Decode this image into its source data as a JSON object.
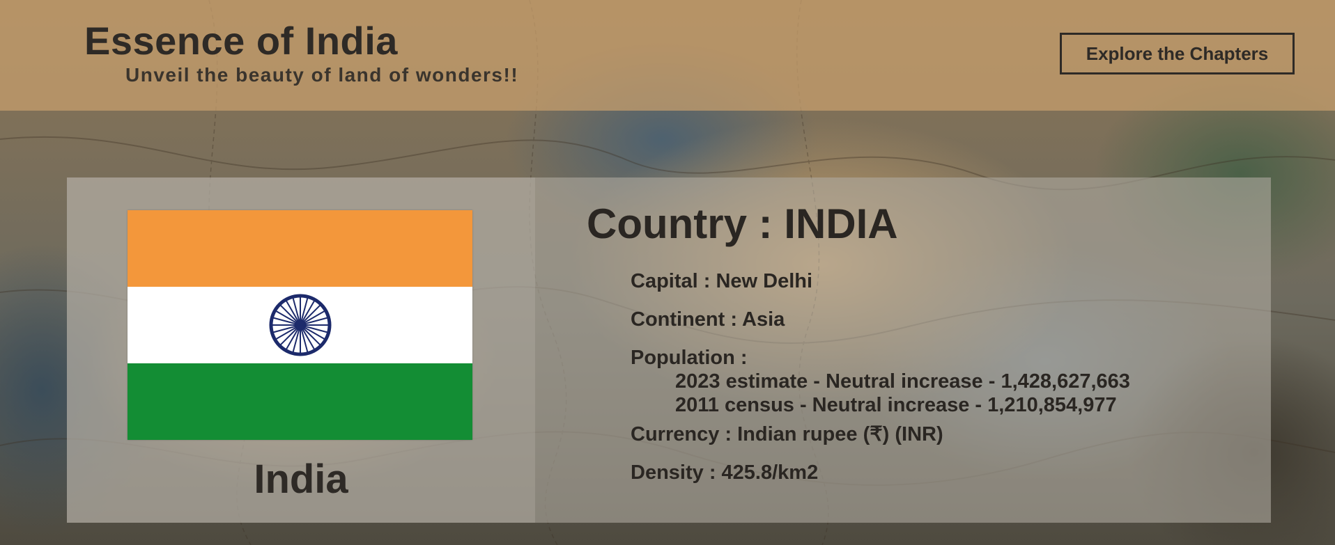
{
  "header": {
    "title": "Essence of India",
    "tagline": "Unveil the beauty of land of wonders!!",
    "cta_label": "Explore the Chapters"
  },
  "flag": {
    "name": "India",
    "icon": "india-flag-icon",
    "colors": {
      "saffron": "#f3973b",
      "white": "#ffffff",
      "green": "#138d34",
      "chakra": "#1c2a6b"
    }
  },
  "details": {
    "heading": "Country : INDIA",
    "capital": "Capital : New Delhi",
    "continent": "Continent : Asia",
    "population_label": "Population :",
    "population_2023": "2023 estimate - Neutral increase - 1,428,627,663",
    "population_2011": "2011 census - Neutral increase - 1,210,854,977",
    "currency": "Currency : Indian rupee (₹) (INR)",
    "density": "Density : 425.8/km2"
  }
}
